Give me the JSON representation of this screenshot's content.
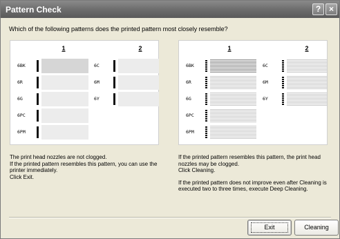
{
  "window": {
    "title": "Pattern Check",
    "help_label": "?",
    "close_label": "×"
  },
  "question": "Which of the following patterns does the printed pattern most closely resemble?",
  "left_pane": {
    "col1": "1",
    "col2": "2",
    "rows_col1": [
      "6BK",
      "6R",
      "6G",
      "6PC",
      "6PM"
    ],
    "rows_col2": [
      "6C",
      "6M",
      "6Y"
    ]
  },
  "right_pane": {
    "col1": "1",
    "col2": "2",
    "rows_col1": [
      "6BK",
      "6R",
      "6G",
      "6PC",
      "6PM"
    ],
    "rows_col2": [
      "6C",
      "6M",
      "6Y"
    ]
  },
  "left_text": {
    "line1": "The print head nozzles are not clogged.",
    "line2": "If the printed pattern resembles this pattern, you can use the",
    "line3": "printer immediately.",
    "line4": "Click Exit."
  },
  "right_text": {
    "line1": "If the printed pattern resembles this pattern, the print head",
    "line2": "nozzles may be clogged.",
    "line3": "Click Cleaning.",
    "line4": "If the printed pattern does not improve even after Cleaning is",
    "line5": "executed two to three times, execute Deep Cleaning."
  },
  "buttons": {
    "exit_label": "Exit",
    "cleaning_label": "Cleaning"
  }
}
